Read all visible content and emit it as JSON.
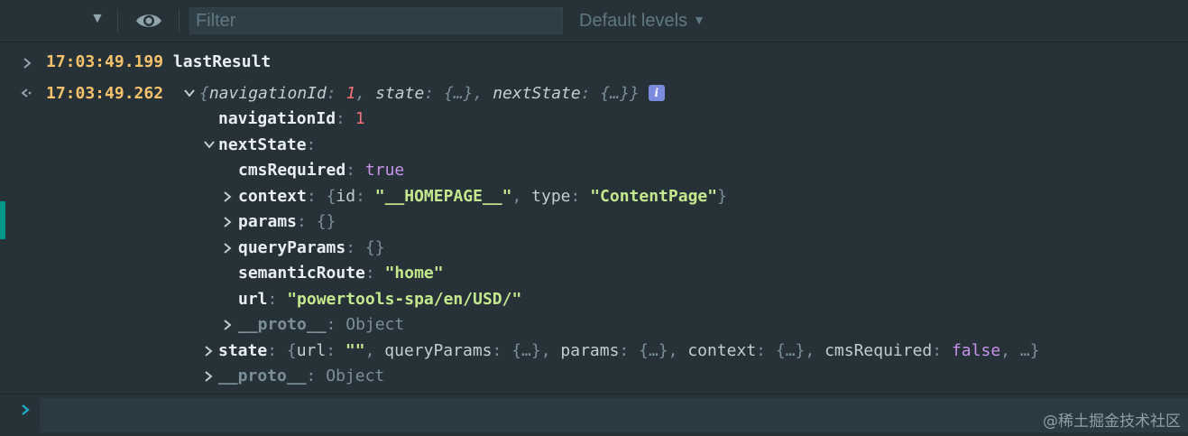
{
  "toolbar": {
    "filter_placeholder": "Filter",
    "levels_label": "Default levels",
    "levels_arrow": "▼",
    "dropdown_arrow": "▼"
  },
  "entries": {
    "log1": {
      "time": "17:03:49.199",
      "text": "lastResult"
    },
    "result": {
      "time": "17:03:49.262",
      "preview": {
        "open": "{",
        "navigationId_key": "navigationId",
        "navigationId_val": "1",
        "state_key": "state",
        "nextState_key": "nextState",
        "collapsed": "{…}",
        "close": "}"
      },
      "info_icon": "i"
    }
  },
  "tree": {
    "navigationId": {
      "key": "navigationId",
      "value": "1"
    },
    "nextState": {
      "key": "nextState",
      "cmsRequired": {
        "key": "cmsRequired",
        "value": "true"
      },
      "context": {
        "key": "context",
        "id_key": "id",
        "id_val": "\"__HOMEPAGE__\"",
        "type_key": "type",
        "type_val": "\"ContentPage\""
      },
      "params": {
        "key": "params",
        "value": "{}"
      },
      "queryParams": {
        "key": "queryParams",
        "value": "{}"
      },
      "semanticRoute": {
        "key": "semanticRoute",
        "value": "\"home\""
      },
      "url": {
        "key": "url",
        "value": "\"powertools-spa/en/USD/\""
      },
      "proto": {
        "key": "__proto__",
        "value": "Object"
      }
    },
    "state": {
      "key": "state",
      "url_key": "url",
      "url_val": "\"\"",
      "queryParams_key": "queryParams",
      "params_key": "params",
      "context_key": "context",
      "cmsRequired_key": "cmsRequired",
      "cmsRequired_val": "false",
      "collapsed": "{…}",
      "ellipsis": "…"
    },
    "proto": {
      "key": "__proto__",
      "value": "Object"
    }
  },
  "watermark": "@稀土掘金技术社区",
  "colors": {
    "background": "#263238",
    "timestamp": "#f5c26b",
    "string": "#c3e88d",
    "number": "#f07178",
    "boolean": "#c792ea",
    "accent": "#009688"
  },
  "icons": [
    "dropdown-arrow-icon",
    "eye-icon",
    "chevron-right-icon",
    "return-arrow-icon",
    "triangle-down-icon",
    "triangle-right-icon",
    "info-icon",
    "prompt-chevron-icon"
  ]
}
